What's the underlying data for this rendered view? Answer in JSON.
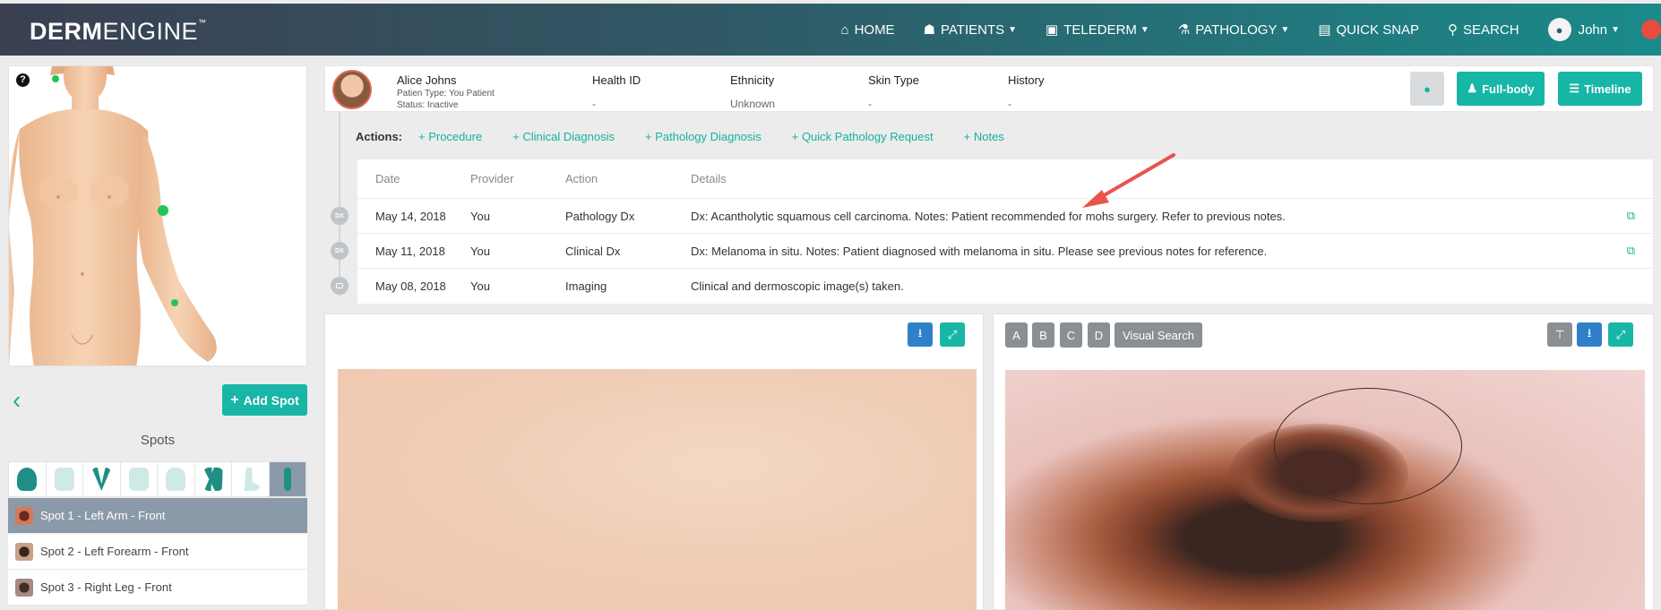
{
  "brand": {
    "strong": "DERM",
    "light": "ENGINE",
    "tm": "™"
  },
  "nav": {
    "home": "HOME",
    "patients": "PATIENTS",
    "telederm": "TELEDERM",
    "pathology": "PATHOLOGY",
    "quick_snap": "QUICK SNAP",
    "search": "SEARCH",
    "user": "John"
  },
  "patient": {
    "name": "Alice Johns",
    "type_label": "Patien Type:",
    "type_value": "You Patient",
    "status_label": "Status:",
    "status_value": "Inactive",
    "fields": [
      {
        "label": "Health ID",
        "value": "-"
      },
      {
        "label": "Ethnicity",
        "value": "Unknown"
      },
      {
        "label": "Skin Type",
        "value": "-"
      },
      {
        "label": "History",
        "value": "-"
      }
    ]
  },
  "header_buttons": {
    "full_body": "Full-body",
    "timeline": "Timeline"
  },
  "actions": {
    "label": "Actions:",
    "items": [
      "+ Procedure",
      "+ Clinical Diagnosis",
      "+ Pathology Diagnosis",
      "+ Quick Pathology Request",
      "+ Notes"
    ]
  },
  "timeline": {
    "columns": [
      "Date",
      "Provider",
      "Action",
      "Details"
    ],
    "rows": [
      {
        "badge": "DX",
        "date": "May 14, 2018",
        "provider": "You",
        "action": "Pathology Dx",
        "details": "Dx: Acantholytic squamous cell carcinoma. Notes: Patient recommended for mohs surgery. Refer to previous notes."
      },
      {
        "badge": "DX",
        "date": "May 11, 2018",
        "provider": "You",
        "action": "Clinical Dx",
        "details": "Dx: Melanoma in situ. Notes: Patient diagnosed with melanoma in situ. Please see previous notes for reference."
      },
      {
        "badge": "",
        "date": "May 08, 2018",
        "provider": "You",
        "action": "Imaging",
        "details": "Clinical and dermoscopic image(s) taken."
      }
    ]
  },
  "left": {
    "add_spot": "Add Spot",
    "spots_title": "Spots",
    "spots": [
      {
        "label": "Spot 1 - Left Arm - Front"
      },
      {
        "label": "Spot 2 - Left Forearm - Front"
      },
      {
        "label": "Spot 3 - Right Leg - Front"
      }
    ]
  },
  "image_tools": {
    "a": "A",
    "b": "B",
    "c": "C",
    "d": "D",
    "visual_search": "Visual Search"
  },
  "colors": {
    "accent": "#17b6a6",
    "blue": "#2f80c8",
    "gray_btn": "#8a8f93",
    "arrow": "#e8534a"
  }
}
